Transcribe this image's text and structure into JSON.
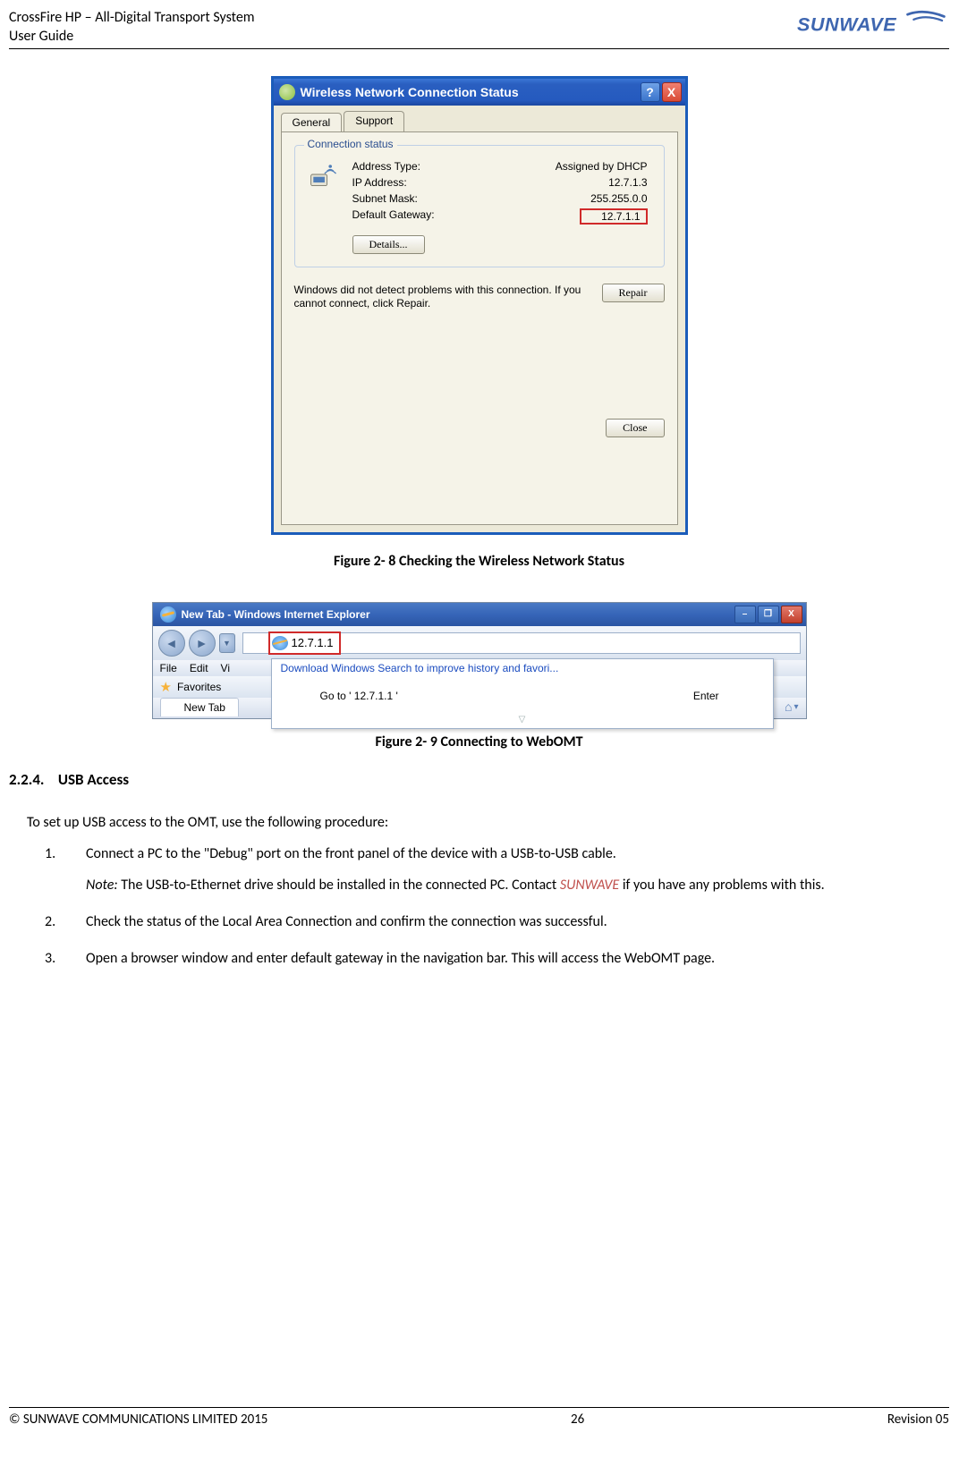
{
  "header": {
    "title_line1": "CrossFire HP – All-Digital Transport System",
    "title_line2": "User Guide",
    "brand": "SUNWAVE"
  },
  "dialog1": {
    "title": "Wireless Network Connection Status",
    "tab_general": "General",
    "tab_support": "Support",
    "group_title": "Connection status",
    "addr_type_k": "Address Type:",
    "addr_type_v": "Assigned by DHCP",
    "ip_k": "IP Address:",
    "ip_v": "12.7.1.3",
    "mask_k": "Subnet Mask:",
    "mask_v": "255.255.0.0",
    "gw_k": "Default Gateway:",
    "gw_v": "12.7.1.1",
    "details_btn": "Details...",
    "repair_msg": "Windows did not detect problems with this connection. If you cannot connect, click Repair.",
    "repair_btn": "Repair",
    "close_btn": "Close",
    "help_glyph": "?",
    "x_glyph": "X"
  },
  "fig1_caption": "Figure 2- 8 Checking the Wireless Network Status",
  "ie": {
    "title": "New Tab - Windows Internet Explorer",
    "min_glyph": "–",
    "max_glyph": "❐",
    "x_glyph": "X",
    "back_glyph": "◄",
    "fwd_glyph": "►",
    "dd_glyph": "▼",
    "addr": "12.7.1.1",
    "dl_hint": "Download Windows Search to improve history and favori...",
    "menu_file": "File",
    "menu_edit": "Edit",
    "menu_vi": "Vi",
    "goto_text": "Go to ' 12.7.1.1 '",
    "enter_text": "Enter",
    "tri_glyph": "▽",
    "fav_star": "★",
    "fav_label": "Favorites",
    "newtab_label": "New Tab",
    "home_glyph": "⌂",
    "home_dd": "▾"
  },
  "fig2_caption": "Figure 2- 9 Connecting to WebOMT",
  "section": {
    "heading_num": "2.2.4.",
    "heading_text": "USB Access",
    "intro": "To set up USB access to the OMT, use the following procedure:",
    "item1_num": "1.",
    "item1_text": "Connect a PC to the \"Debug\" port on the front panel of the device with a USB-to-USB cable.",
    "note_label": "Note:",
    "note_before": " The USB-to-Ethernet drive should be installed in the connected PC. Contact ",
    "note_brand": "SUNWAVE",
    "note_after": " if you have any problems with this.",
    "item2_num": "2.",
    "item2_text": "Check the status of the Local Area Connection and confirm the connection was successful.",
    "item3_num": "3.",
    "item3_text": "Open a browser window and enter default gateway in the navigation bar. This will access the WebOMT page."
  },
  "footer": {
    "copyright": "© SUNWAVE COMMUNICATIONS LIMITED 2015",
    "page": "26",
    "revision": "Revision 05"
  }
}
